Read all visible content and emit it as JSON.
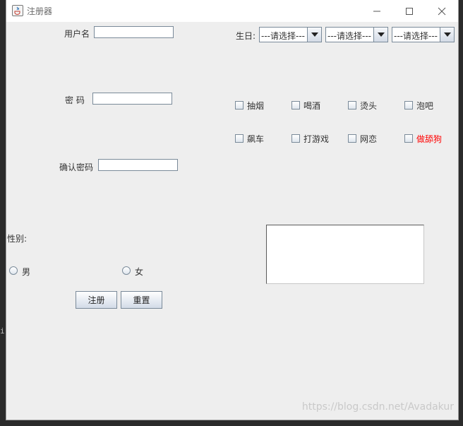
{
  "window": {
    "title": "注册器"
  },
  "form": {
    "username_label": "用户名",
    "username_value": "",
    "password_label": "密  码",
    "password_value": "",
    "confirm_label": "确认密码",
    "confirm_value": "",
    "gender_label": "性别:",
    "gender_options": [
      "男",
      "女"
    ],
    "register_button": "注册",
    "reset_button": "重置"
  },
  "birthday": {
    "label": "生日:",
    "combos": [
      "---请选择---",
      "---请选择---",
      "---请选择---"
    ]
  },
  "hobbies": {
    "row1": [
      "抽烟",
      "喝酒",
      "烫头",
      "泡吧"
    ],
    "row2": [
      "飙车",
      "打游戏",
      "网恋",
      "做舔狗"
    ],
    "highlight_color": "#ff0000"
  },
  "notes": {
    "value": ""
  },
  "watermark": "https://blog.csdn.net/Avadakur",
  "background_char": "i"
}
